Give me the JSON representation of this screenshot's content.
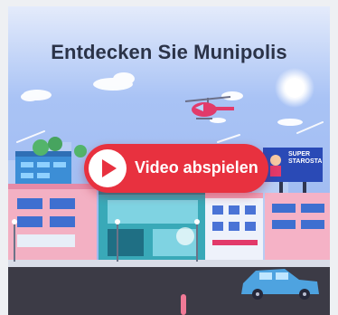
{
  "hero": {
    "title": "Entdecken Sie Munipolis",
    "play_label": "Video abspielen",
    "billboard_text": "SUPER STAROSTA"
  },
  "icons": {
    "play": "play-icon"
  },
  "colors": {
    "sky_top": "#8fb3f2",
    "sky_bottom": "#dfe8fb",
    "accent_red": "#e8313f",
    "title_text": "#2b3348",
    "road": "#3c3b46",
    "car": "#4ea3e0"
  }
}
